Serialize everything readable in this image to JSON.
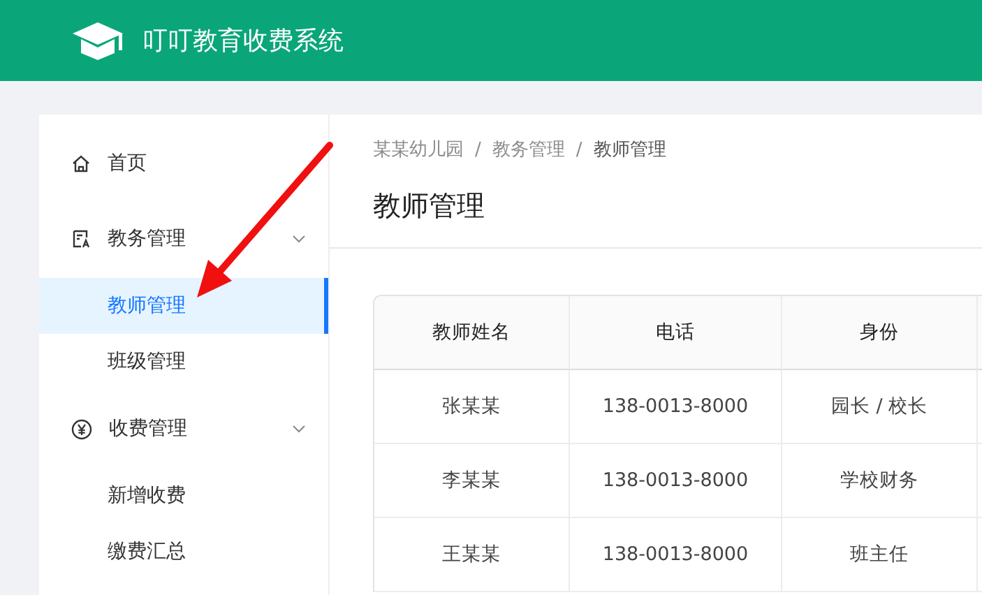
{
  "header": {
    "title": "叮叮教育收费系统"
  },
  "sidebar": {
    "items": [
      {
        "label": "首页",
        "selected": false
      },
      {
        "label": "教务管理",
        "selected": false,
        "expanded": true,
        "children": [
          {
            "label": "教师管理",
            "selected": true
          },
          {
            "label": "班级管理",
            "selected": false
          }
        ]
      },
      {
        "label": "收费管理",
        "selected": false,
        "expanded": true,
        "children": [
          {
            "label": "新增收费",
            "selected": false
          },
          {
            "label": "缴费汇总",
            "selected": false
          }
        ]
      }
    ]
  },
  "breadcrumb": [
    "某某幼儿园",
    "教务管理",
    "教师管理"
  ],
  "breadcrumb_separators": [
    "/",
    "/"
  ],
  "page_title": "教师管理",
  "table": {
    "columns": [
      "教师姓名",
      "电话",
      "身份"
    ],
    "rows": [
      [
        "张某某",
        "138-0013-8000",
        "园长 / 校长"
      ],
      [
        "李某某",
        "138-0013-8000",
        "学校财务"
      ],
      [
        "王某某",
        "138-0013-8000",
        "班主任"
      ]
    ]
  }
}
